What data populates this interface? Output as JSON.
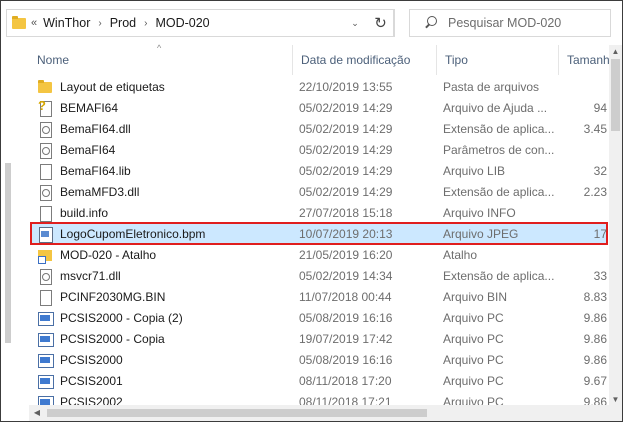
{
  "address": {
    "overflow_glyph": "«",
    "crumbs": [
      "WinThor",
      "Prod",
      "MOD-020"
    ],
    "separator": "›",
    "dropdown_glyph": "⌄",
    "refresh_glyph": "↻"
  },
  "search": {
    "placeholder": "Pesquisar MOD-020"
  },
  "columns": {
    "name": "Nome",
    "date": "Data de modificação",
    "type": "Tipo",
    "size": "Tamanho",
    "sort_glyph": "^"
  },
  "files": [
    {
      "icon": "folder-icon",
      "name": "Layout de etiquetas",
      "date": "22/10/2019 13:55",
      "type": "Pasta de arquivos",
      "size": ""
    },
    {
      "icon": "help-file-icon",
      "name": "BEMAFI64",
      "date": "05/02/2019 14:29",
      "type": "Arquivo de Ajuda ...",
      "size": "94"
    },
    {
      "icon": "dll-file-icon",
      "name": "BemaFI64.dll",
      "date": "05/02/2019 14:29",
      "type": "Extensão de aplica...",
      "size": "3.45"
    },
    {
      "icon": "config-file-icon",
      "name": "BemaFI64",
      "date": "05/02/2019 14:29",
      "type": "Parâmetros de con...",
      "size": ""
    },
    {
      "icon": "file-icon",
      "name": "BemaFI64.lib",
      "date": "05/02/2019 14:29",
      "type": "Arquivo LIB",
      "size": "32"
    },
    {
      "icon": "dll-file-icon",
      "name": "BemaMFD3.dll",
      "date": "05/02/2019 14:29",
      "type": "Extensão de aplica...",
      "size": "2.23"
    },
    {
      "icon": "file-icon",
      "name": "build.info",
      "date": "27/07/2018 15:18",
      "type": "Arquivo INFO",
      "size": ""
    },
    {
      "icon": "image-file-icon",
      "name": "LogoCupomEletronico.bpm",
      "date": "10/07/2019 20:13",
      "type": "Arquivo JPEG",
      "size": "17",
      "selected": true
    },
    {
      "icon": "shortcut-icon",
      "name": "MOD-020 - Atalho",
      "date": "21/05/2019 16:20",
      "type": "Atalho",
      "size": ""
    },
    {
      "icon": "dll-file-icon",
      "name": "msvcr71.dll",
      "date": "05/02/2019 14:34",
      "type": "Extensão de aplica...",
      "size": "33"
    },
    {
      "icon": "file-icon",
      "name": "PCINF2030MG.BIN",
      "date": "11/07/2018 00:44",
      "type": "Arquivo BIN",
      "size": "8.83"
    },
    {
      "icon": "pc-file-icon",
      "name": "PCSIS2000 - Copia (2)",
      "date": "05/08/2019 16:16",
      "type": "Arquivo PC",
      "size": "9.86"
    },
    {
      "icon": "pc-file-icon",
      "name": "PCSIS2000 - Copia",
      "date": "19/07/2019 17:42",
      "type": "Arquivo PC",
      "size": "9.86"
    },
    {
      "icon": "pc-file-icon",
      "name": "PCSIS2000",
      "date": "05/08/2019 16:16",
      "type": "Arquivo PC",
      "size": "9.86"
    },
    {
      "icon": "pc-file-icon",
      "name": "PCSIS2001",
      "date": "08/11/2018 17:20",
      "type": "Arquivo PC",
      "size": "9.67"
    },
    {
      "icon": "pc-file-icon",
      "name": "PCSIS2002",
      "date": "08/11/2018 17:21",
      "type": "Arquivo PC",
      "size": "9.86"
    }
  ],
  "colors": {
    "selection": "#cce8ff",
    "highlight_border": "#e01e1e",
    "header_text": "#4c607a"
  }
}
